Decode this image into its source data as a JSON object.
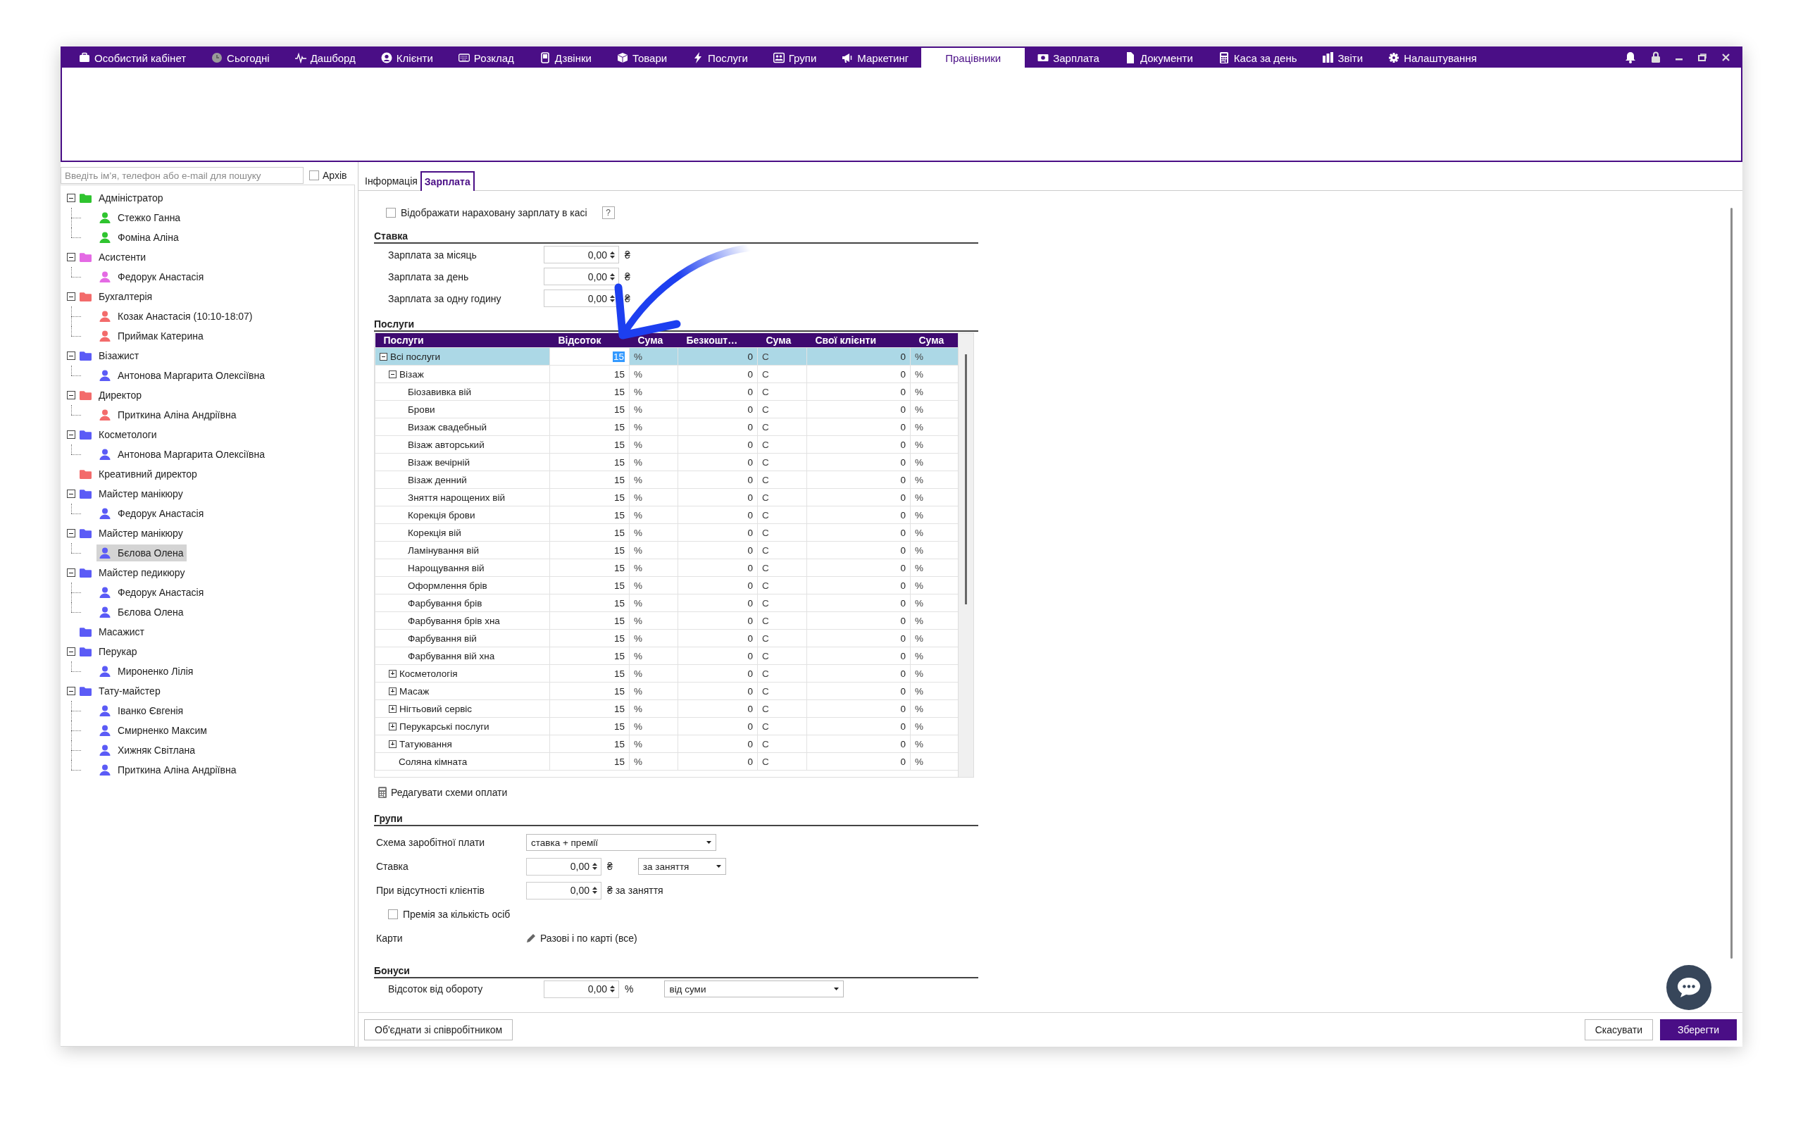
{
  "nav": {
    "items": [
      {
        "label": "Особистий кабінет",
        "selected": false
      },
      {
        "label": "Сьогодні",
        "selected": false
      },
      {
        "label": "Дашборд",
        "selected": false
      },
      {
        "label": "Клієнти",
        "selected": false
      },
      {
        "label": "Розклад",
        "selected": false
      },
      {
        "label": "Дзвінки",
        "selected": false
      },
      {
        "label": "Товари",
        "selected": false
      },
      {
        "label": "Послуги",
        "selected": false
      },
      {
        "label": "Групи",
        "selected": false
      },
      {
        "label": "Маркетинг",
        "selected": false
      },
      {
        "label": "Працівники",
        "selected": true
      },
      {
        "label": "Зарплата",
        "selected": false
      },
      {
        "label": "Документи",
        "selected": false
      },
      {
        "label": "Каса за день",
        "selected": false
      },
      {
        "label": "Звіти",
        "selected": false
      },
      {
        "label": "Налаштування",
        "selected": false
      }
    ]
  },
  "sidebar": {
    "search": {
      "placeholder": "Введіть ім’я, телефон або e-mail для пошуку"
    },
    "archive": {
      "label": "Архів",
      "checked": false
    },
    "groups": [
      {
        "label": "Адміністратор",
        "color": "#2fc42f",
        "expanded": true,
        "children": [
          {
            "label": "Стежко Ганна",
            "selected": false
          },
          {
            "label": "Фоміна Аліна",
            "selected": false
          }
        ]
      },
      {
        "label": "Асистенти",
        "color": "#e46ae4",
        "expanded": true,
        "children": [
          {
            "label": "Федорук Анастасія",
            "selected": false
          }
        ]
      },
      {
        "label": "Бухгалтерія",
        "color": "#f36b6b",
        "expanded": true,
        "children": [
          {
            "label": "Козак Анастасія (10:10-18:07)",
            "selected": false
          },
          {
            "label": "Приймак Катерина",
            "selected": false
          }
        ]
      },
      {
        "label": "Візажист",
        "color": "#5b5bf6",
        "expanded": true,
        "children": [
          {
            "label": "Антонова Маргарита Олексіївна",
            "selected": false
          }
        ]
      },
      {
        "label": "Директор",
        "color": "#f36b6b",
        "expanded": true,
        "children": [
          {
            "label": "Приткина Аліна Андріївна",
            "selected": false
          }
        ]
      },
      {
        "label": "Косметологи",
        "color": "#5b5bf6",
        "expanded": true,
        "children": [
          {
            "label": "Антонова Маргарита Олексіївна",
            "selected": false
          }
        ]
      },
      {
        "label": "Креативний директор",
        "color": "#f36b6b"
      },
      {
        "label": "Майстер манікюру",
        "color": "#5b5bf6",
        "expanded": true,
        "children": [
          {
            "label": "Федорук Анастасія",
            "selected": false
          }
        ]
      },
      {
        "label": "Майстер манікюру",
        "color": "#5b5bf6",
        "expanded": true,
        "children": [
          {
            "label": "Бєлова Олена",
            "selected": true
          }
        ]
      },
      {
        "label": "Майстер педикюру",
        "color": "#5b5bf6",
        "expanded": true,
        "children": [
          {
            "label": "Федорук Анастасія",
            "selected": false
          },
          {
            "label": "Бєлова Олена",
            "selected": false
          }
        ]
      },
      {
        "label": "Масажист",
        "color": "#5b5bf6"
      },
      {
        "label": "Перукар",
        "color": "#5b5bf6",
        "expanded": true,
        "children": [
          {
            "label": "Мироненко Лілія",
            "selected": false
          }
        ]
      },
      {
        "label": "Тату-майстер",
        "color": "#5b5bf6",
        "expanded": true,
        "children": [
          {
            "label": "Іванко Євгенія",
            "selected": false
          },
          {
            "label": "Смирненко Максим",
            "selected": false
          },
          {
            "label": "Хижняк Світлана",
            "selected": false
          },
          {
            "label": "Приткина Аліна Андріївна",
            "selected": false
          }
        ]
      }
    ]
  },
  "tabs": [
    {
      "label": "Інформація",
      "selected": false
    },
    {
      "label": "Зарплата",
      "selected": true
    }
  ],
  "salary": {
    "show_in_cash": {
      "label": "Відображати нараховану зарплату в касі",
      "checked": false
    },
    "help": "?",
    "rate": {
      "title": "Ставка",
      "fields": [
        {
          "label": "Зарплата за місяць",
          "value": "0,00",
          "unit": "₴"
        },
        {
          "label": "Зарплата за день",
          "value": "0,00",
          "unit": "₴"
        },
        {
          "label": "Зарплата за одну годину",
          "value": "0,00",
          "unit": "₴"
        }
      ]
    }
  },
  "services": {
    "title": "Послуги",
    "columns": [
      "Послуги",
      "Відсоток",
      "Сума",
      "Безкошт…",
      "Сума",
      "Свої клієнти",
      "Сума"
    ],
    "rows": [
      {
        "name": "Всі послуги",
        "percent": "15",
        "percent_unit": "%",
        "free": "0",
        "free_unit": "С",
        "own": "0",
        "own_unit": "%",
        "selected": true,
        "expanded": true,
        "children": [
          {
            "name": "Візаж",
            "percent": "15",
            "percent_unit": "%",
            "free": "0",
            "free_unit": "С",
            "own": "0",
            "own_unit": "%",
            "selected": false,
            "expanded": true,
            "children": [
              {
                "name": "Біозавивка вій",
                "percent": "15",
                "percent_unit": "%",
                "free": "0",
                "free_unit": "С",
                "own": "0",
                "own_unit": "%",
                "selected": false
              },
              {
                "name": "Брови",
                "percent": "15",
                "percent_unit": "%",
                "free": "0",
                "free_unit": "С",
                "own": "0",
                "own_unit": "%",
                "selected": false
              },
              {
                "name": "Визаж свадебный",
                "percent": "15",
                "percent_unit": "%",
                "free": "0",
                "free_unit": "С",
                "own": "0",
                "own_unit": "%",
                "selected": false
              },
              {
                "name": "Візаж авторський",
                "percent": "15",
                "percent_unit": "%",
                "free": "0",
                "free_unit": "С",
                "own": "0",
                "own_unit": "%",
                "selected": false
              },
              {
                "name": "Візаж вечірній",
                "percent": "15",
                "percent_unit": "%",
                "free": "0",
                "free_unit": "С",
                "own": "0",
                "own_unit": "%",
                "selected": false
              },
              {
                "name": "Візаж денний",
                "percent": "15",
                "percent_unit": "%",
                "free": "0",
                "free_unit": "С",
                "own": "0",
                "own_unit": "%",
                "selected": false
              },
              {
                "name": "Зняття нарощених вій",
                "percent": "15",
                "percent_unit": "%",
                "free": "0",
                "free_unit": "С",
                "own": "0",
                "own_unit": "%",
                "selected": false
              },
              {
                "name": "Корекція брови",
                "percent": "15",
                "percent_unit": "%",
                "free": "0",
                "free_unit": "С",
                "own": "0",
                "own_unit": "%",
                "selected": false
              },
              {
                "name": "Корекція вій",
                "percent": "15",
                "percent_unit": "%",
                "free": "0",
                "free_unit": "С",
                "own": "0",
                "own_unit": "%",
                "selected": false
              },
              {
                "name": "Ламінування вій",
                "percent": "15",
                "percent_unit": "%",
                "free": "0",
                "free_unit": "С",
                "own": "0",
                "own_unit": "%",
                "selected": false
              },
              {
                "name": "Нарощування вій",
                "percent": "15",
                "percent_unit": "%",
                "free": "0",
                "free_unit": "С",
                "own": "0",
                "own_unit": "%",
                "selected": false
              },
              {
                "name": "Оформлення брів",
                "percent": "15",
                "percent_unit": "%",
                "free": "0",
                "free_unit": "С",
                "own": "0",
                "own_unit": "%",
                "selected": false
              },
              {
                "name": "Фарбування брів",
                "percent": "15",
                "percent_unit": "%",
                "free": "0",
                "free_unit": "С",
                "own": "0",
                "own_unit": "%",
                "selected": false
              },
              {
                "name": "Фарбування брів хна",
                "percent": "15",
                "percent_unit": "%",
                "free": "0",
                "free_unit": "С",
                "own": "0",
                "own_unit": "%",
                "selected": false
              },
              {
                "name": "Фарбування вій",
                "percent": "15",
                "percent_unit": "%",
                "free": "0",
                "free_unit": "С",
                "own": "0",
                "own_unit": "%",
                "selected": false
              },
              {
                "name": "Фарбування вій хна",
                "percent": "15",
                "percent_unit": "%",
                "free": "0",
                "free_unit": "С",
                "own": "0",
                "own_unit": "%",
                "selected": false
              }
            ]
          },
          {
            "name": "Косметологія",
            "percent": "15",
            "percent_unit": "%",
            "free": "0",
            "free_unit": "С",
            "own": "0",
            "own_unit": "%",
            "selected": false,
            "expanded": false
          },
          {
            "name": "Масаж",
            "percent": "15",
            "percent_unit": "%",
            "free": "0",
            "free_unit": "С",
            "own": "0",
            "own_unit": "%",
            "selected": false,
            "expanded": false
          },
          {
            "name": "Нігтьовий сервіс",
            "percent": "15",
            "percent_unit": "%",
            "free": "0",
            "free_unit": "С",
            "own": "0",
            "own_unit": "%",
            "selected": false,
            "expanded": false
          },
          {
            "name": "Перукарські послуги",
            "percent": "15",
            "percent_unit": "%",
            "free": "0",
            "free_unit": "С",
            "own": "0",
            "own_unit": "%",
            "selected": false,
            "expanded": false
          },
          {
            "name": "Татуювання",
            "percent": "15",
            "percent_unit": "%",
            "free": "0",
            "free_unit": "С",
            "own": "0",
            "own_unit": "%",
            "selected": false,
            "expanded": false
          },
          {
            "name": "Соляна кімната",
            "percent": "15",
            "percent_unit": "%",
            "free": "0",
            "free_unit": "С",
            "own": "0",
            "own_unit": "%",
            "selected": false
          }
        ]
      }
    ],
    "edit_link": "Редагувати схеми оплати"
  },
  "groups": {
    "title": "Групи",
    "pay_scheme": {
      "label": "Схема заробітної плати",
      "value": "ставка + премії"
    },
    "rate": {
      "label": "Ставка",
      "value": "0,00",
      "unit": "₴",
      "period": "за заняття"
    },
    "no_clients": {
      "label": "При відсутності клієнтів",
      "value": "0,00",
      "suffix": "₴ за заняття"
    },
    "bonus_per_person": {
      "label": "Премія за кількість осіб",
      "checked": false
    },
    "cards": {
      "label": "Карти",
      "value": "Разові і по карті (все)"
    }
  },
  "bonuses": {
    "title": "Бонуси",
    "turnover": {
      "label": "Відсоток від обороту",
      "value": "0,00",
      "unit": "%",
      "basis": "від суми"
    }
  },
  "footer": {
    "merge": "Об'єднати зі співробітником",
    "cancel": "Скасувати",
    "save": "Зберегти"
  }
}
